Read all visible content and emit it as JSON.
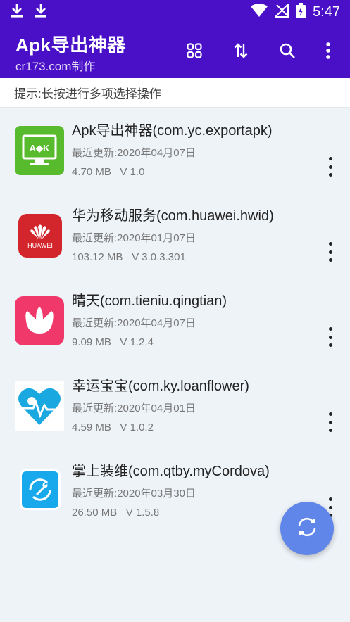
{
  "status_bar": {
    "time": "5:47",
    "left_icons": [
      "download-icon",
      "download-icon"
    ],
    "right_icons": [
      "wifi-icon",
      "no-signal-icon",
      "battery-charging-icon"
    ]
  },
  "toolbar": {
    "title": "Apk导出神器",
    "subtitle": "cr173.com制作",
    "actions": [
      "grid-view-icon",
      "sort-icon",
      "search-icon",
      "more-vertical-icon"
    ],
    "color": "#4a10c8"
  },
  "hint": "提示:长按进行多项选择操作",
  "apps": [
    {
      "name": "Apk导出神器(com.yc.exportapk)",
      "date": "最近更新:2020年04月07日",
      "size": "4.70 MB",
      "version": "V 1.0",
      "icon": "apk-exporter-app-icon"
    },
    {
      "name": "华为移动服务(com.huawei.hwid)",
      "date": "最近更新:2020年01月07日",
      "size": "103.12 MB",
      "version": "V 3.0.3.301",
      "icon": "huawei-app-icon",
      "icon_label": "HUAWEI"
    },
    {
      "name": "晴天(com.tieniu.qingtian)",
      "date": "最近更新:2020年04月07日",
      "size": "9.09 MB",
      "version": "V 1.2.4",
      "icon": "lotus-app-icon"
    },
    {
      "name": "幸运宝宝(com.ky.loanflower)",
      "date": "最近更新:2020年04月01日",
      "size": "4.59 MB",
      "version": "V 1.0.2",
      "icon": "heart-pulse-app-icon"
    },
    {
      "name": "掌上装维(com.qtby.myCordova)",
      "date": "最近更新:2020年03月30日",
      "size": "26.50 MB",
      "version": "V 1.5.8",
      "icon": "wrench-sync-app-icon"
    }
  ],
  "fab": {
    "icon": "refresh-icon",
    "color": "#5f86e8"
  }
}
